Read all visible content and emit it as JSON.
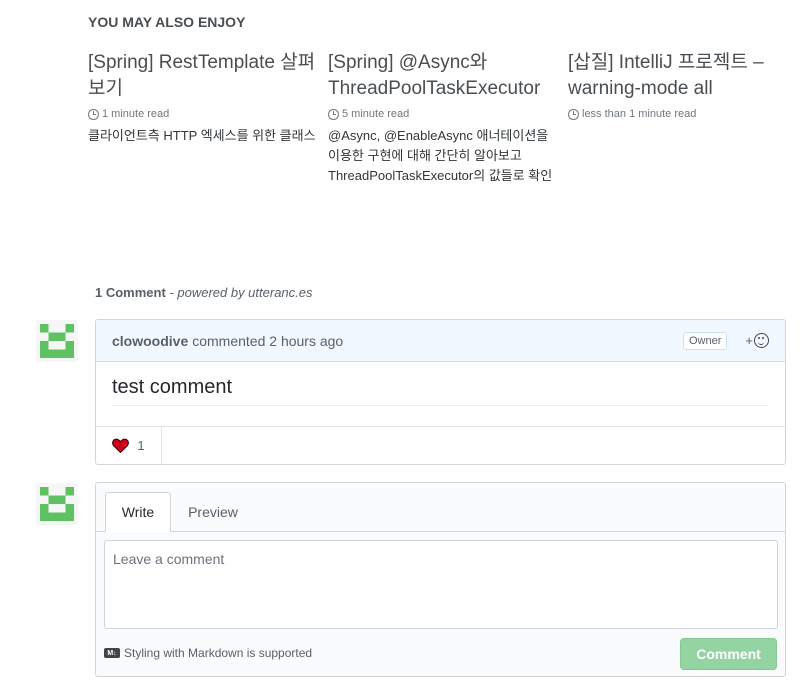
{
  "related": {
    "heading": "YOU MAY ALSO ENJOY",
    "cards": [
      {
        "title": "[Spring] RestTemplate 살펴보기",
        "read_time": "1 minute read",
        "excerpt": "클라이언트측 HTTP 엑세스를 위한 클래스"
      },
      {
        "title": "[Spring] @Async와 ThreadPoolTaskExecutor",
        "read_time": "5 minute read",
        "excerpt": "@Async, @EnableAsync 애너테이션을 이용한 구현에 대해 간단히 알아보고 ThreadPoolTaskExecutor의 값들로 확인"
      },
      {
        "title": "[삽질] IntelliJ 프로젝트 – warning-mode all",
        "read_time": "less than 1 minute read",
        "excerpt": ""
      }
    ]
  },
  "comments": {
    "count_label": "1 Comment",
    "powered_by": "- powered by utteranc.es",
    "items": [
      {
        "author": "clowoodive",
        "action": "commented 2 hours ago",
        "badge": "Owner",
        "add_reaction": "+",
        "body": "test comment",
        "reactions": [
          {
            "icon": "heart-icon",
            "count": "1",
            "color": "#d0021b"
          }
        ]
      }
    ]
  },
  "compose": {
    "tab_write": "Write",
    "tab_preview": "Preview",
    "placeholder": "Leave a comment",
    "markdown_note": "Styling with Markdown is supported",
    "md_icon_text": "M↓",
    "submit_label": "Comment"
  },
  "colors": {
    "accent_green": "#94d3a2",
    "header_blue": "#f1f8ff",
    "avatar_green": "#5ec262"
  }
}
